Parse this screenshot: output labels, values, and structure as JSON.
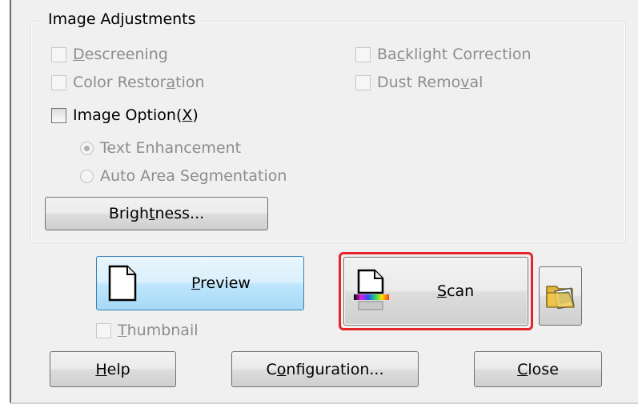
{
  "group": {
    "title": "Image Adjustments"
  },
  "checkboxes": {
    "descreening": {
      "pre": "",
      "key": "D",
      "post": "escreening",
      "checked": false,
      "enabled": false
    },
    "color_restoration": {
      "pre": "Color Restor",
      "key": "a",
      "post": "tion",
      "checked": false,
      "enabled": false
    },
    "backlight_correction": {
      "pre": "Ba",
      "key": "c",
      "post": "klight Correction",
      "checked": false,
      "enabled": false
    },
    "dust_removal": {
      "pre": "Dust Remo",
      "key": "v",
      "post": "al",
      "checked": false,
      "enabled": false
    },
    "image_option": {
      "pre": "Image Option(",
      "key": "X",
      "post": ")",
      "checked": false,
      "enabled": true
    },
    "thumbnail": {
      "pre": "",
      "key": "T",
      "post": "humbnail",
      "checked": false,
      "enabled": false
    }
  },
  "radios": {
    "text_enhancement": {
      "label": "Text Enhancement",
      "selected": true,
      "enabled": false
    },
    "auto_area_segmentation": {
      "label": "Auto Area Segmentation",
      "selected": false,
      "enabled": false
    }
  },
  "buttons": {
    "brightness": {
      "pre": "Brigh",
      "key": "t",
      "post": "ness..."
    },
    "preview": {
      "pre": "",
      "key": "P",
      "post": "review"
    },
    "scan": {
      "pre": "",
      "key": "S",
      "post": "can"
    },
    "help": {
      "pre": "",
      "key": "H",
      "post": "elp"
    },
    "configuration": {
      "pre": "C",
      "key": "o",
      "post": "nfiguration..."
    },
    "close": {
      "pre": "",
      "key": "C",
      "post": "lose"
    }
  },
  "icons": {
    "preview": "document-page-icon",
    "scan": "scanner-page-color-icon",
    "folder": "folder-image-icon"
  },
  "colors": {
    "highlight": "#e5252a",
    "preview_button": "#bee6fd",
    "disabled_text": "#8d8d8d"
  }
}
